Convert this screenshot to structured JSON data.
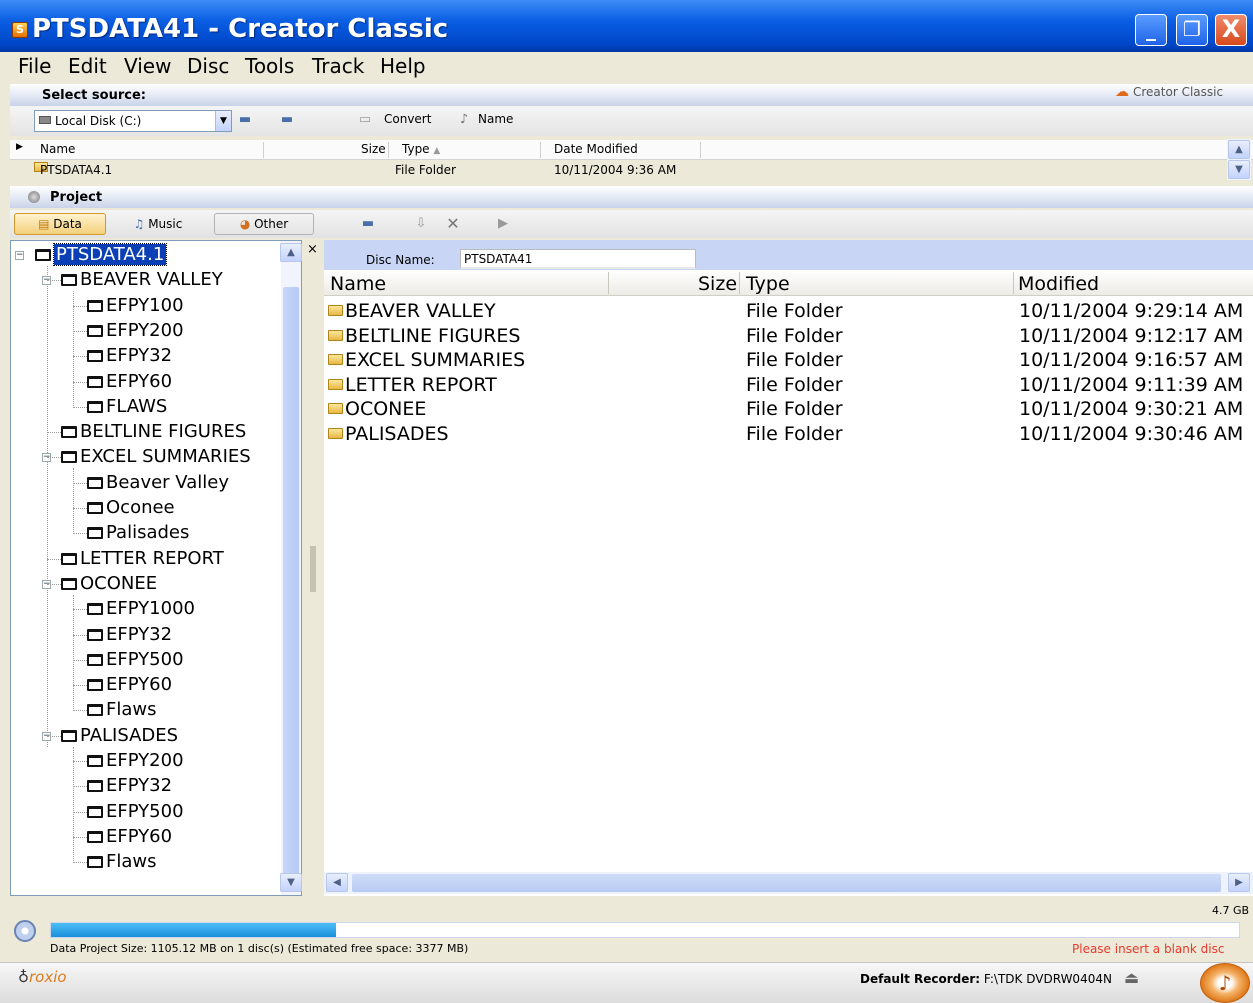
{
  "window": {
    "title": "PTSDATA41 - Creator Classic",
    "min": "_",
    "max": "❐",
    "close": "X"
  },
  "menu": [
    "File",
    "Edit",
    "View",
    "Disc",
    "Tools",
    "Track",
    "Help"
  ],
  "source": {
    "label": "Select source:",
    "brand": "Creator Classic",
    "drive": "Local Disk (C:)",
    "convert_label": "Convert",
    "name_label": "Name",
    "columns": [
      "Name",
      "Size",
      "Type",
      "Date Modified"
    ],
    "sort_indicator": "▲",
    "rows": [
      {
        "name": "PTSDATA4.1",
        "size": "",
        "type": "File Folder",
        "modified": "10/11/2004 9:36 AM"
      }
    ]
  },
  "project": {
    "label": "Project",
    "tabs": [
      "Data",
      "Music",
      "Other"
    ],
    "close": "×",
    "disc_name_label": "Disc Name:",
    "disc_name": "PTSDATA41"
  },
  "tree": {
    "root": "PTSDATA4.1",
    "items": [
      {
        "label": "BEAVER VALLEY",
        "level": 1,
        "expanded": true
      },
      {
        "label": "EFPY100",
        "level": 2
      },
      {
        "label": "EFPY200",
        "level": 2
      },
      {
        "label": "EFPY32",
        "level": 2
      },
      {
        "label": "EFPY60",
        "level": 2
      },
      {
        "label": "FLAWS",
        "level": 2
      },
      {
        "label": "BELTLINE FIGURES",
        "level": 1
      },
      {
        "label": "EXCEL SUMMARIES",
        "level": 1,
        "expanded": true
      },
      {
        "label": "Beaver Valley",
        "level": 2
      },
      {
        "label": "Oconee",
        "level": 2
      },
      {
        "label": "Palisades",
        "level": 2
      },
      {
        "label": "LETTER REPORT",
        "level": 1
      },
      {
        "label": "OCONEE",
        "level": 1,
        "expanded": true
      },
      {
        "label": "EFPY1000",
        "level": 2
      },
      {
        "label": "EFPY32",
        "level": 2
      },
      {
        "label": "EFPY500",
        "level": 2
      },
      {
        "label": "EFPY60",
        "level": 2
      },
      {
        "label": "Flaws",
        "level": 2
      },
      {
        "label": "PALISADES",
        "level": 1,
        "expanded": true
      },
      {
        "label": "EFPY200",
        "level": 2
      },
      {
        "label": "EFPY32",
        "level": 2
      },
      {
        "label": "EFPY500",
        "level": 2
      },
      {
        "label": "EFPY60",
        "level": 2
      },
      {
        "label": "Flaws",
        "level": 2
      }
    ]
  },
  "list": {
    "columns": [
      "Name",
      "Size",
      "Type",
      "Modified"
    ],
    "rows": [
      {
        "name": "BEAVER VALLEY",
        "size": "",
        "type": "File Folder",
        "modified": "10/11/2004 9:29:14 AM"
      },
      {
        "name": "BELTLINE FIGURES",
        "size": "",
        "type": "File Folder",
        "modified": "10/11/2004 9:12:17 AM"
      },
      {
        "name": "EXCEL SUMMARIES",
        "size": "",
        "type": "File Folder",
        "modified": "10/11/2004 9:16:57 AM"
      },
      {
        "name": "LETTER REPORT",
        "size": "",
        "type": "File Folder",
        "modified": "10/11/2004 9:11:39 AM"
      },
      {
        "name": "OCONEE",
        "size": "",
        "type": "File Folder",
        "modified": "10/11/2004 9:30:21 AM"
      },
      {
        "name": "PALISADES",
        "size": "",
        "type": "File Folder",
        "modified": "10/11/2004 9:30:46 AM"
      }
    ]
  },
  "status": {
    "capacity": "4.7 GB",
    "progress_fraction": 0.24,
    "summary": "Data Project Size: 1105.12 MB  on 1 disc(s)  (Estimated free space: 3377 MB)",
    "warning": "Please insert a blank disc",
    "brand": "roxio",
    "recorder_label": "Default Recorder:",
    "recorder_value": "F:\\TDK DVDRW0404N"
  },
  "colors": {
    "titlebar": "#0a5ee3",
    "selection": "#0a3fb5",
    "progress": "#1a8fdc",
    "warning": "#e8392b"
  }
}
